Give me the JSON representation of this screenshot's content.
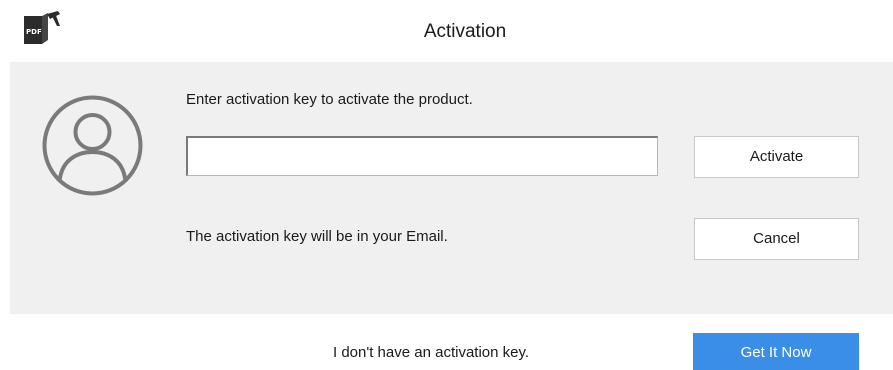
{
  "window": {
    "title": "Activation",
    "logo_icon": "pdf-app-logo-icon",
    "logo_text": "PDF"
  },
  "panel": {
    "avatar_icon": "user-avatar-icon",
    "prompt": "Enter activation key to activate the product.",
    "key_input": {
      "value": "",
      "placeholder": ""
    },
    "activate_label": "Activate",
    "cancel_label": "Cancel",
    "note": "The activation key will be in your Email."
  },
  "footer": {
    "no_key_text": "I don't have an activation key.",
    "get_it_now_label": "Get It Now"
  },
  "colors": {
    "panel_bg": "#f0f0f0",
    "accent": "#3a8ee6",
    "avatar_stroke": "#7a7a7a"
  }
}
